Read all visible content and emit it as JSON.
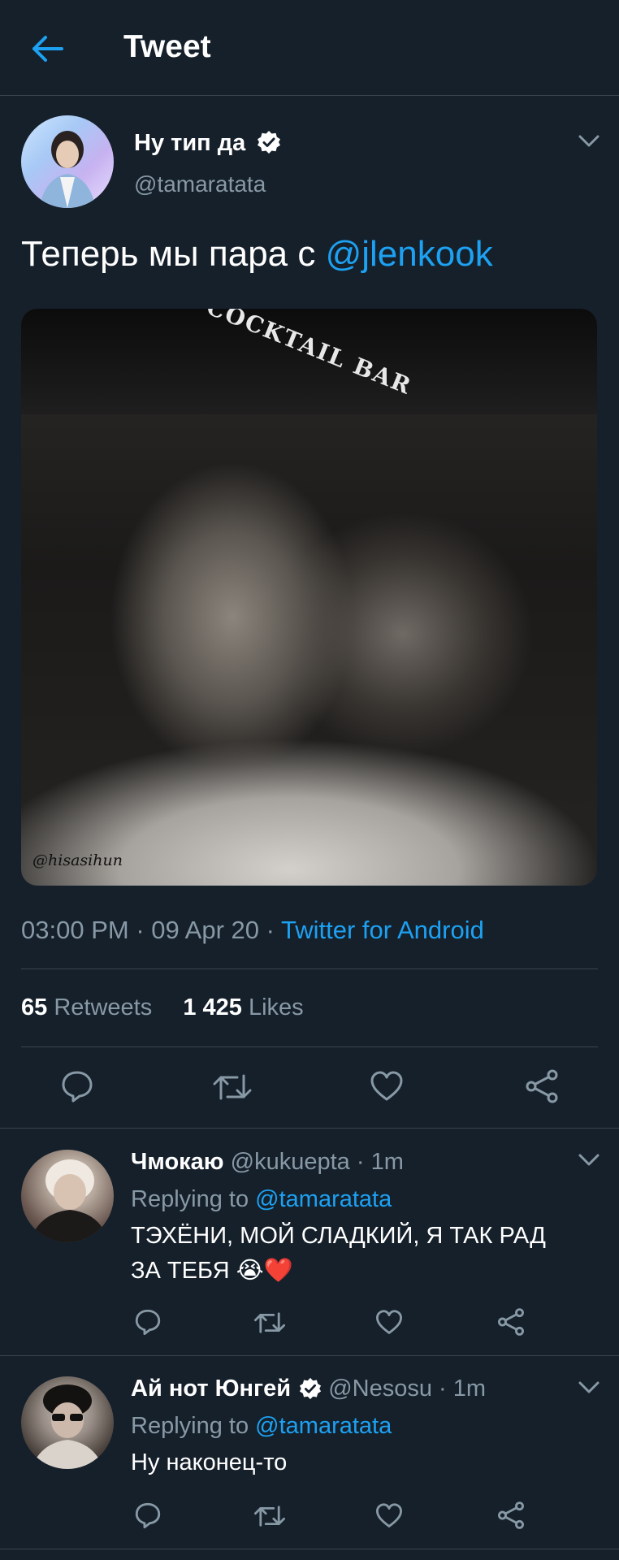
{
  "header": {
    "title": "Tweet",
    "back_icon": "arrow-left-icon"
  },
  "tweet": {
    "display_name": "Ну тип да",
    "handle": "@tamaratata",
    "text_before_mention": "Теперь мы пара с ",
    "mention": "@jlenkook",
    "photo_sign_text": "COCKTAIL BAR",
    "photo_watermark": "@hisasihun",
    "time": "03:00 PM",
    "date": "09 Apr 20",
    "separator": " · ",
    "source": "Twitter for Android",
    "retweets_count": "65",
    "retweets_label": "Retweets",
    "likes_count": "1 425",
    "likes_label": "Likes"
  },
  "replies": [
    {
      "display_name": "Чмокаю",
      "handle": "@kukuepta",
      "age": "1m",
      "replying_label": "Replying to",
      "replying_to": "@tamaratata",
      "text_line1": "ТЭХЁНИ, МОЙ СЛАДКИЙ, Я ТАК РАД",
      "text_line2": "ЗА ТЕБЯ",
      "emoji": "😭❤️"
    },
    {
      "display_name": "Ай нот Юнгей",
      "handle": "@Nesosu",
      "age": "1m",
      "replying_label": "Replying to",
      "replying_to": "@tamaratata",
      "text_line1": "Ну наконец-то",
      "verified": true
    }
  ],
  "colors": {
    "background": "#15202b",
    "accent": "#1da1f2",
    "muted": "#8899a6",
    "divider": "#38444d"
  },
  "icons": [
    "arrow-left-icon",
    "verified-badge-icon",
    "chevron-down-icon",
    "reply-icon",
    "retweet-icon",
    "like-icon",
    "share-icon"
  ]
}
